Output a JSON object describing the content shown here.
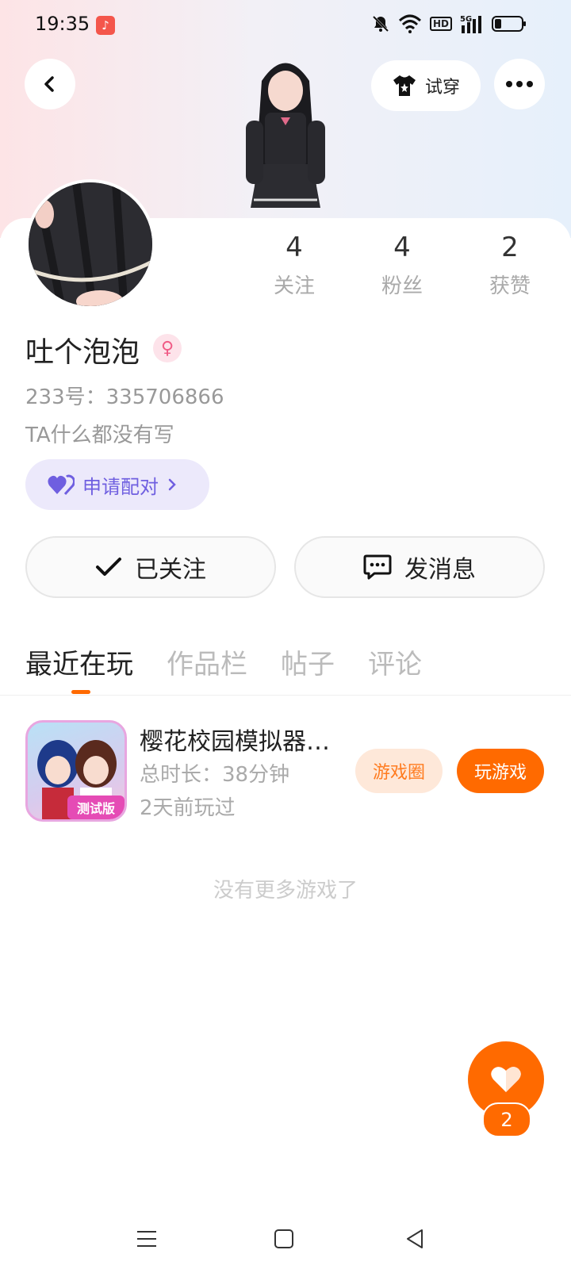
{
  "status_bar": {
    "time": "19:35",
    "icons": [
      "music-app-icon",
      "mute-icon",
      "wifi-icon",
      "hd-icon",
      "5g-signal-icon",
      "battery-icon"
    ],
    "hd_label": "HD",
    "network_label": "5G"
  },
  "header": {
    "try_on_label": "试穿"
  },
  "stats": [
    {
      "value": "4",
      "label": "关注"
    },
    {
      "value": "4",
      "label": "粉丝"
    },
    {
      "value": "2",
      "label": "获赞"
    }
  ],
  "profile": {
    "name": "吐个泡泡",
    "id_text": "233号：335706866",
    "bio": "TA什么都没有写",
    "pair_label": "申请配对"
  },
  "actions": {
    "follow_label": "已关注",
    "message_label": "发消息"
  },
  "tabs": [
    "最近在玩",
    "作品栏",
    "帖子",
    "评论"
  ],
  "recent_game": {
    "name": "樱花校园模拟器…",
    "duration": "总时长：38分钟",
    "last_played": "2天前玩过",
    "icon_badge": "测试版",
    "circle_label": "游戏圈",
    "play_label": "玩游戏"
  },
  "no_more_text": "没有更多游戏了",
  "like": {
    "count": "2"
  },
  "colors": {
    "accent": "#ff6a00",
    "pair": "#6f5fe0",
    "gender": "#f05b86"
  }
}
